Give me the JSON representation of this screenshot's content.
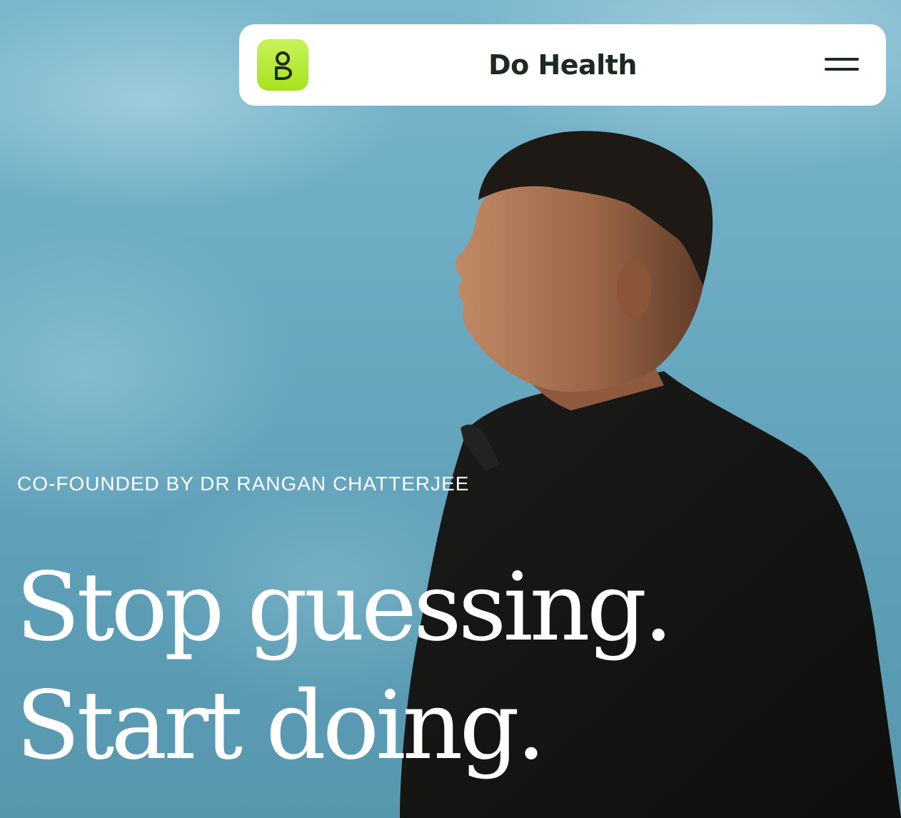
{
  "nav": {
    "brand": "Do Health",
    "logo_icon": "person-icon",
    "menu_icon": "hamburger-menu-icon"
  },
  "hero": {
    "eyebrow": "CO-FOUNDED BY DR RANGAN CHATTERJEE",
    "headline_line1": "Stop guessing.",
    "headline_line2": "Start doing."
  },
  "colors": {
    "sky": "#6aaac0",
    "nav_background": "#ffffff",
    "brand_text": "#1d2a1f",
    "logo_green": "#b5e930",
    "hero_text": "#ffffff"
  }
}
